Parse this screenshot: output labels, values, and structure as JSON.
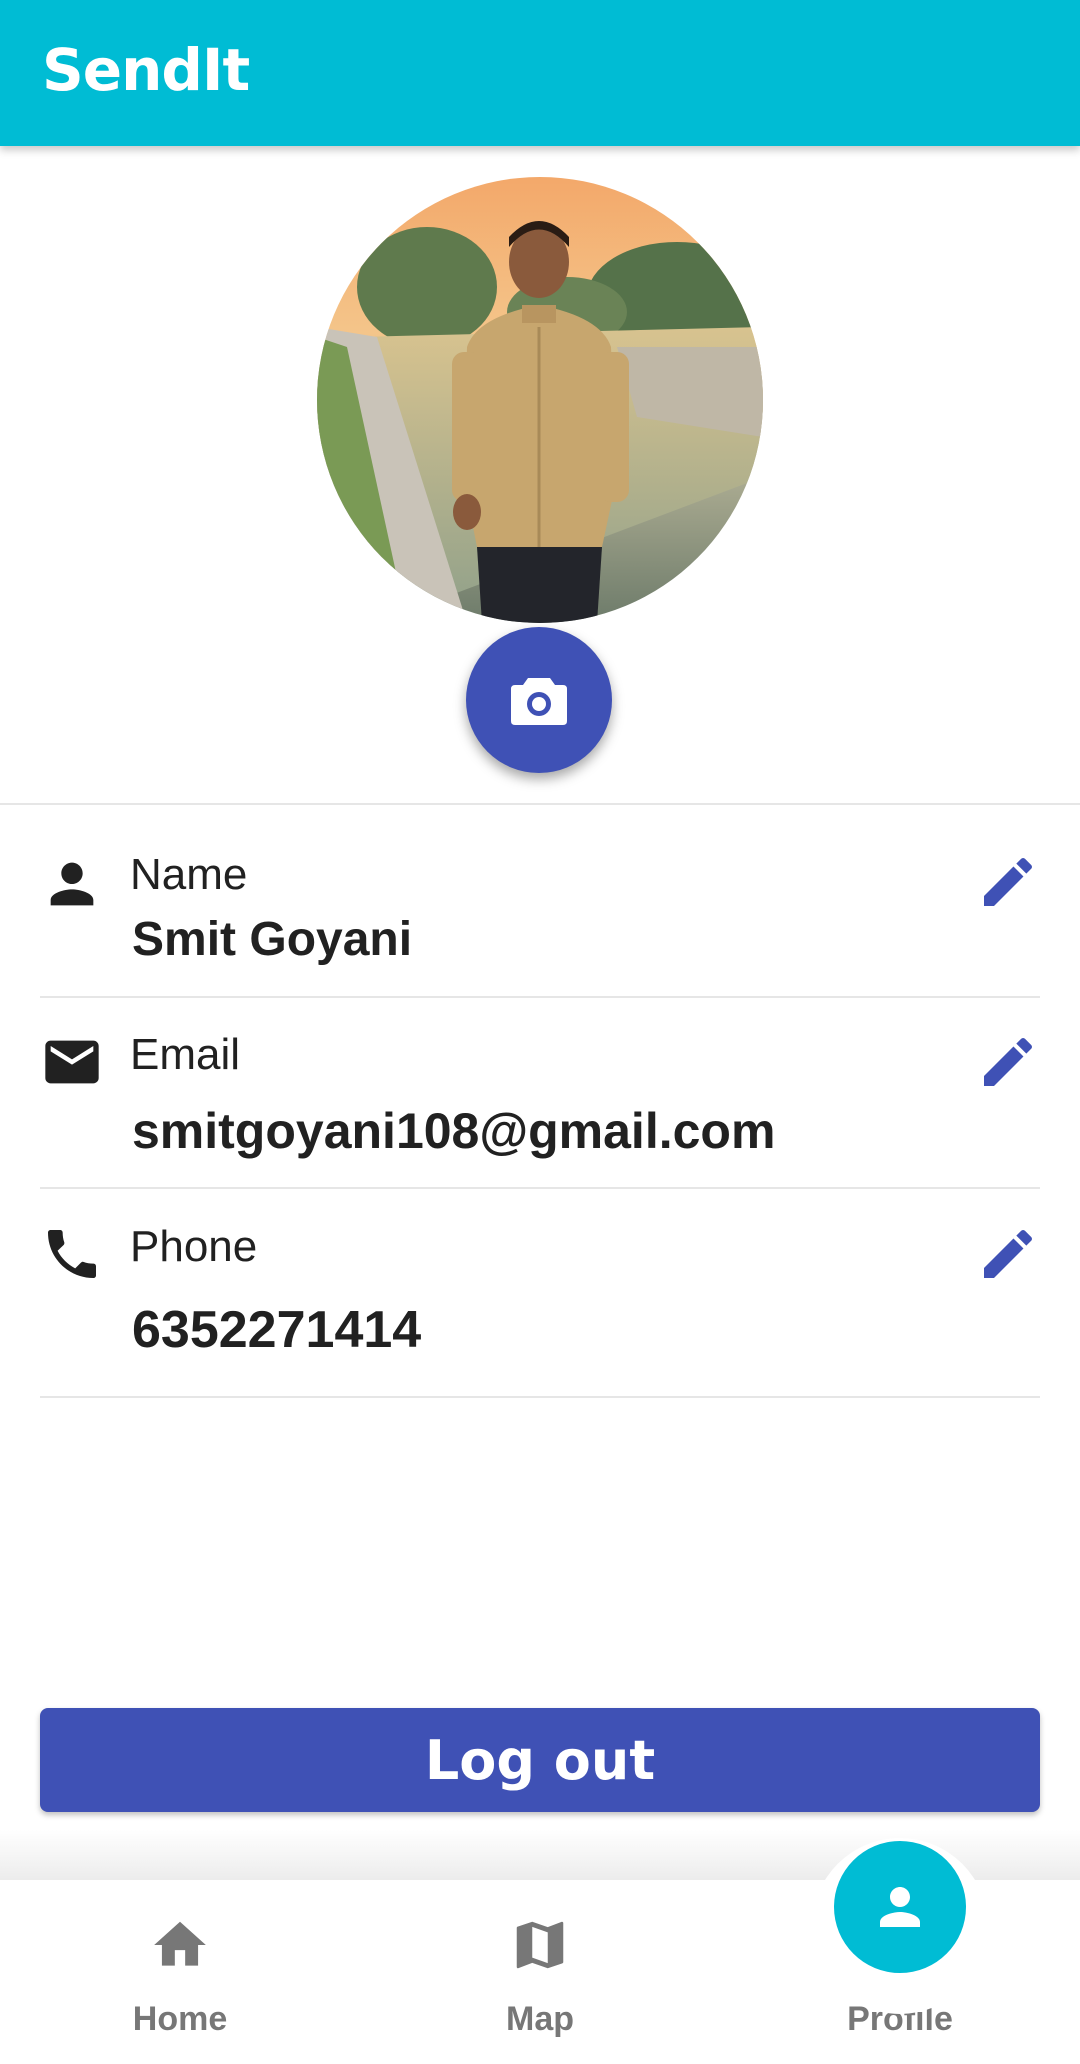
{
  "app_bar": {
    "title": "SendIt"
  },
  "profile_photo": {
    "description": "user-profile-photo",
    "camera_icon": "camera-icon"
  },
  "fields": [
    {
      "icon": "person-icon",
      "label": "Name",
      "value": "Smit Goyani",
      "edit_icon": "pencil-icon"
    },
    {
      "icon": "mail-icon",
      "label": "Email",
      "value": "smitgoyani108@gmail.com",
      "edit_icon": "pencil-icon"
    },
    {
      "icon": "phone-icon",
      "label": "Phone",
      "value": "6352271414",
      "edit_icon": "pencil-icon"
    }
  ],
  "logout": {
    "label": "Log out"
  },
  "bottom_nav": {
    "items": [
      {
        "icon": "home-icon",
        "label": "Home",
        "active": false
      },
      {
        "icon": "map-icon",
        "label": "Map",
        "active": false
      },
      {
        "icon": "person-icon",
        "label": "Profile",
        "active": true
      }
    ]
  },
  "colors": {
    "primary_cyan": "#00bcd4",
    "accent_indigo": "#3f51b5",
    "text_dark": "#212121",
    "nav_inactive": "#777777"
  }
}
